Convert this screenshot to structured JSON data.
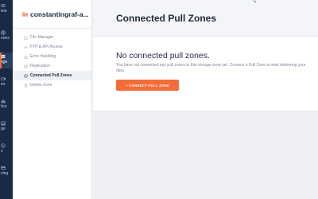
{
  "app": {
    "accent": "#f36d38",
    "rail_bg": "#1a2a46"
  },
  "rail": {
    "items": [
      {
        "label": "iew",
        "icon": "eye-icon"
      },
      {
        "label": "ones",
        "icon": "globe-icon"
      },
      {
        "label": "age",
        "icon": "storage-icon"
      },
      {
        "label": "eo",
        "icon": "video-icon"
      },
      {
        "label": "tics",
        "icon": "chart-icon"
      },
      {
        "label": "ge",
        "icon": "image-icon"
      },
      {
        "label": "s",
        "icon": "dns-icon"
      },
      {
        "label": "cing",
        "icon": "billing-icon"
      }
    ]
  },
  "zone": {
    "name": "constantingraf-a..."
  },
  "menu": {
    "items": [
      {
        "label": "File Manager",
        "icon": "folder-icon"
      },
      {
        "label": "FTP & API Access",
        "icon": "key-icon"
      },
      {
        "label": "Error Handling",
        "icon": "warning-icon"
      },
      {
        "label": "Replication",
        "icon": "globe-icon"
      },
      {
        "label": "Connected Pull Zones",
        "icon": "link-icon",
        "active": true
      },
      {
        "label": "Delete Zone",
        "icon": "trash-icon"
      }
    ]
  },
  "main": {
    "title": "Connected Pull Zones",
    "empty_title": "No connected pull zones.",
    "empty_desc": "You have not connected any pull zones to this storage zone yet. Connect a Pull Zone to start delivering your data.",
    "connect_label": "+ CONNECT PULL ZONE"
  }
}
